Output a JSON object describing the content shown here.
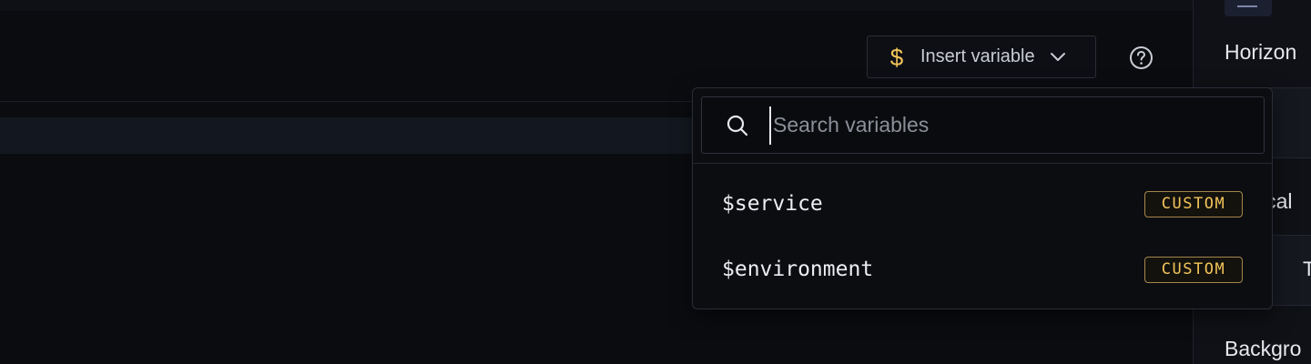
{
  "toolbar": {
    "insert_variable": {
      "icon": "dollar-icon",
      "icon_glyph": "$",
      "label": "Insert variable",
      "chevron": "chevron-down-icon"
    },
    "help": {
      "icon": "help-circle-icon"
    }
  },
  "dropdown": {
    "search": {
      "placeholder": "Search variables",
      "value": ""
    },
    "variables": [
      {
        "name": "$service",
        "badge": "CUSTOM"
      },
      {
        "name": "$environment",
        "badge": "CUSTOM"
      }
    ]
  },
  "right_panel": {
    "labels": [
      "Horizon",
      "ical",
      "Backgro"
    ],
    "field_glyphs": [
      "",
      "T"
    ]
  },
  "colors": {
    "accent_gold": "#f2c45a",
    "background": "#0b0c10",
    "panel": "#0f1116"
  }
}
